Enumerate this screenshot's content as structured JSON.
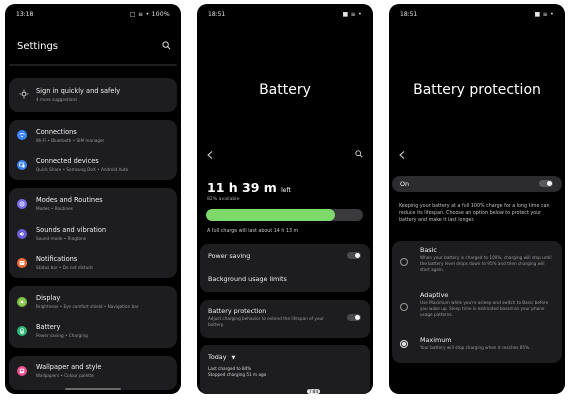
{
  "phone1": {
    "status": {
      "time": "13:18",
      "icons": "□ ≡ • 100%"
    },
    "title": "Settings",
    "search_icon": "search-icon",
    "signin": {
      "label": "Sign in quickly and safely",
      "sub": "4 more suggestions",
      "icon": "key-icon"
    },
    "items": [
      {
        "label": "Connections",
        "sub": "Wi-Fi • Bluetooth • SIM manager",
        "color": "#3b82f6",
        "icon": "wifi-icon"
      },
      {
        "label": "Connected devices",
        "sub": "Quick Share • Samsung DeX • Android Auto",
        "color": "#3b82f6",
        "icon": "devices-icon"
      },
      {
        "label": "Modes and Routines",
        "sub": "Modes • Routines",
        "color": "#7c6cf0",
        "icon": "modes-icon"
      },
      {
        "label": "Sounds and vibration",
        "sub": "Sound mode • Ringtone",
        "color": "#6c5cdf",
        "icon": "sound-icon"
      },
      {
        "label": "Notifications",
        "sub": "Status bar • Do not disturb",
        "color": "#f26b3a",
        "icon": "bell-icon"
      },
      {
        "label": "Display",
        "sub": "Brightness • Eye comfort shield • Navigation bar",
        "color": "#7fc241",
        "icon": "sun-icon"
      },
      {
        "label": "Battery",
        "sub": "Power saving • Charging",
        "color": "#2bb673",
        "icon": "battery-icon"
      },
      {
        "label": "Wallpaper and style",
        "sub": "Wallpapers • Colour palette",
        "color": "#ec4d8c",
        "icon": "palette-icon"
      }
    ]
  },
  "phone2": {
    "status": {
      "time": "18:51",
      "icons": "■ ≡ •"
    },
    "title": "Battery",
    "remaining_time": "11 h 39 m",
    "remaining_suffix": "left",
    "available": "82% available",
    "level": 0.82,
    "bar_color": "#7ed96b",
    "full_charge_note": "A full charge will last about 14 h 13 m",
    "power_saving": "Power saving",
    "background_limits": "Background usage limits",
    "protection": {
      "label": "Battery protection",
      "sub": "Adjust charging behavior to extend the lifespan of your battery."
    },
    "today": {
      "label": "Today",
      "line1": "Last charged to 84%",
      "line2": "Stopped charging 51 m ago"
    },
    "peek_time": "7:84",
    "peek_pct": "100"
  },
  "phone3": {
    "status": {
      "time": "18:51",
      "icons": "■ ≡ •"
    },
    "title": "Battery protection",
    "toggle_label": "On",
    "description": "Keeping your battery at a full 100% charge for a long time can reduce its lifespan. Choose an option below to protect your battery and make it last longer.",
    "options": [
      {
        "label": "Basic",
        "desc": "When your battery is charged to 100%, charging will stop until the battery level drops down to 95% and then charging will start again."
      },
      {
        "label": "Adaptive",
        "desc": "Use Maximum while you're asleep and switch to Basic before you wake up. Sleep time is estimated based on your phone usage patterns."
      },
      {
        "label": "Maximum",
        "desc": "Your battery will stop charging when it reaches 85%."
      }
    ],
    "selected": "Maximum"
  }
}
